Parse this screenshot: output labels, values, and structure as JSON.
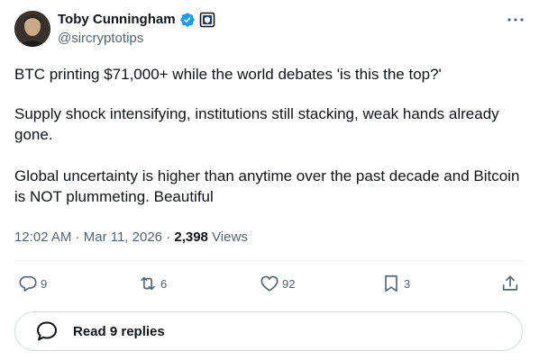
{
  "author": {
    "display_name": "Toby Cunningham",
    "handle": "@sircryptotips"
  },
  "tweet": {
    "paragraph_1": "BTC printing $71,000+ while the world debates 'is this the top?'",
    "paragraph_2": "Supply shock intensifying, institutions still stacking, weak hands already gone.",
    "paragraph_3": "Global uncertainty is higher than anytime over the past decade and Bitcoin is NOT plummeting. Beautiful"
  },
  "meta": {
    "time": "12:02 AM",
    "separator": "·",
    "date": "Mar 11, 2026",
    "views_count": "2,398",
    "views_label": "Views"
  },
  "actions": {
    "replies": "9",
    "reposts": "6",
    "likes": "92",
    "bookmarks": "3"
  },
  "read_replies_label": "Read 9 replies",
  "colors": {
    "text": "#0f1419",
    "muted": "#536471",
    "verified": "#1d9bf0",
    "border": "#cfd9de"
  }
}
